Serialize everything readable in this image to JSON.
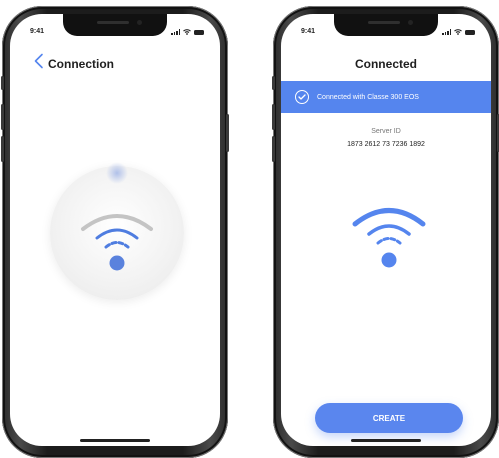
{
  "left_screen": {
    "time": "9:41",
    "title": "Connection",
    "icons": {
      "back": "chevron-left-icon",
      "signal": "cellular-signal-icon",
      "wifi": "wifi-icon",
      "battery": "battery-icon"
    }
  },
  "right_screen": {
    "time": "9:41",
    "title": "Connected",
    "banner_text": "Connected with Classe 300 EOS",
    "server_id_label": "Server ID",
    "server_id_value": "1873 2612 73 7236 1892",
    "create_label": "CREATE",
    "icons": {
      "check": "checkmark-circle-icon",
      "wifi": "wifi-icon"
    }
  },
  "colors": {
    "accent": "#5585EE",
    "wifi_blue": "#4F7DE0",
    "wifi_grey_arc": "#C4C4C4",
    "text_dark": "#1F1F1F"
  }
}
